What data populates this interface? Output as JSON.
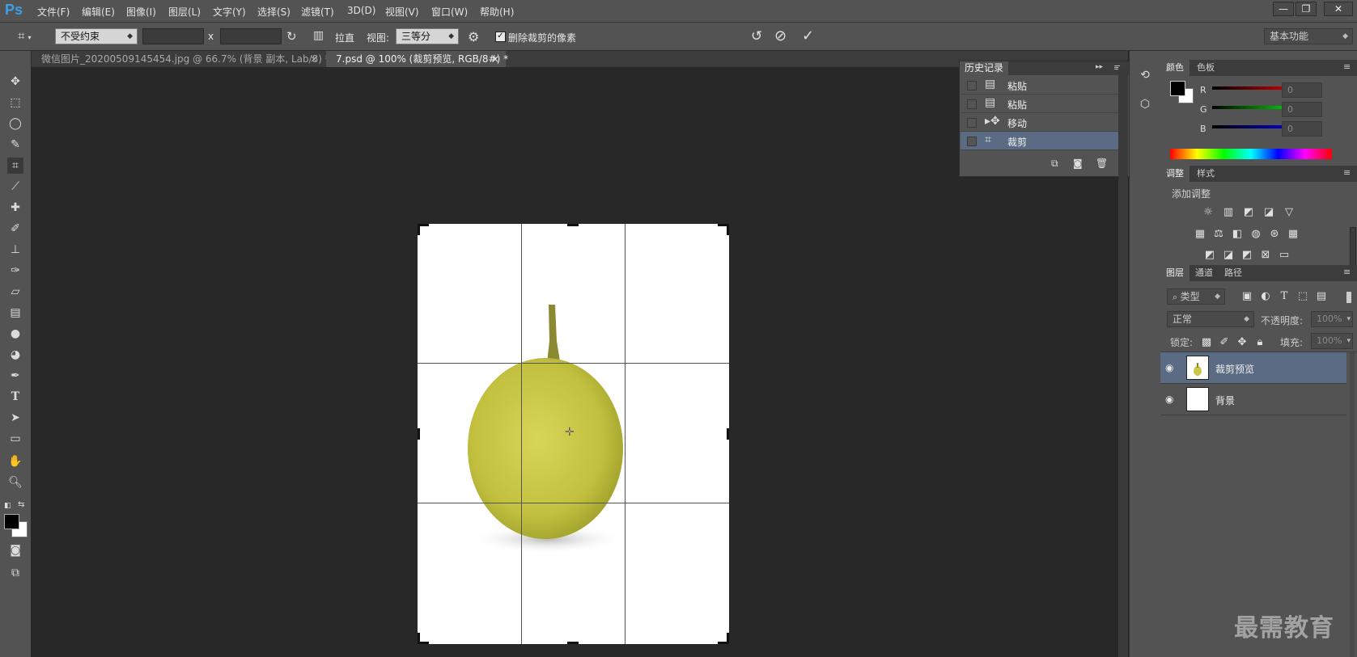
{
  "app": {
    "logo": "Ps"
  },
  "menu": [
    "文件(F)",
    "编辑(E)",
    "图像(I)",
    "图层(L)",
    "文字(Y)",
    "选择(S)",
    "滤镜(T)",
    "3D(D)",
    "视图(V)",
    "窗口(W)",
    "帮助(H)"
  ],
  "window_buttons": {
    "minimize": "—",
    "restore": "❐",
    "close": "✕"
  },
  "options": {
    "ratio_value": "不受约束",
    "width_value": "",
    "x_label": "x",
    "height_value": "",
    "straighten_label": "拉直",
    "view_label": "视图:",
    "view_value": "三等分",
    "delete_pixels_label": "删除裁剪的像素",
    "delete_pixels_checked": true,
    "workspace": "基本功能"
  },
  "tabs": [
    {
      "label": "微信图片_20200509145454.jpg @ 66.7% (背景 副本, Lab/8) *",
      "close": "×",
      "active": false
    },
    {
      "label": "7.psd @ 100% (裁剪预览, RGB/8#) *",
      "close": "×",
      "active": true
    }
  ],
  "history": {
    "title": "历史记录",
    "items": [
      {
        "label": "粘贴",
        "icon": "document-icon"
      },
      {
        "label": "粘贴",
        "icon": "document-icon"
      },
      {
        "label": "移动",
        "icon": "move-icon"
      },
      {
        "label": "裁剪",
        "icon": "crop-icon",
        "selected": true
      }
    ]
  },
  "color_panel": {
    "tabs": [
      "颜色",
      "色板"
    ],
    "channels": [
      {
        "label": "R",
        "value": "0",
        "color": "#d81e1e"
      },
      {
        "label": "G",
        "value": "0",
        "color": "#1ec81e"
      },
      {
        "label": "B",
        "value": "0",
        "color": "#1e3ed8"
      }
    ]
  },
  "adjustments": {
    "tabs": [
      "调整",
      "样式"
    ],
    "heading": "添加调整"
  },
  "layers_panel": {
    "tabs": [
      "图层",
      "通道",
      "路径"
    ],
    "filter_value": "类型",
    "blend_mode": "正常",
    "opacity_label": "不透明度:",
    "opacity_value": "100%",
    "lock_label": "锁定:",
    "fill_label": "填充:",
    "fill_value": "100%",
    "layers": [
      {
        "name": "裁剪预览",
        "selected": true
      },
      {
        "name": "背景",
        "selected": false
      }
    ]
  },
  "watermark": "最需教育",
  "colors": {
    "chrome": "#535353",
    "canvas": "#282828",
    "selection": "#5b6b83",
    "pear": "#c9c947"
  }
}
